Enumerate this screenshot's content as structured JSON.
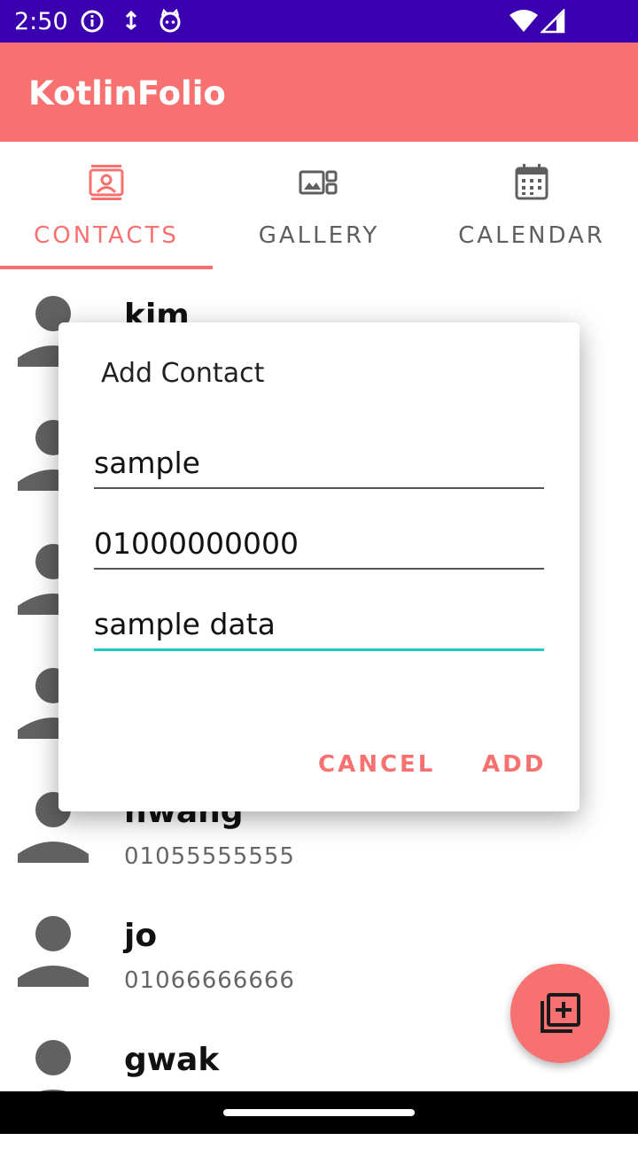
{
  "status_bar": {
    "time": "2:50",
    "icons": [
      "info-icon",
      "usb-debug-icon",
      "cat-icon",
      "wifi-icon",
      "signal-icon"
    ]
  },
  "app_bar": {
    "title": "KotlinFolio",
    "color": "#f87171"
  },
  "tabs": [
    {
      "label": "CONTACTS",
      "icon": "contacts-icon",
      "active": true
    },
    {
      "label": "GALLERY",
      "icon": "gallery-icon",
      "active": false
    },
    {
      "label": "CALENDAR",
      "icon": "calendar-icon",
      "active": false
    }
  ],
  "contacts": [
    {
      "name": "kim",
      "phone": ""
    },
    {
      "name": "",
      "phone": ""
    },
    {
      "name": "",
      "phone": ""
    },
    {
      "name": "",
      "phone": ""
    },
    {
      "name": "hwang",
      "phone": "01055555555"
    },
    {
      "name": "jo",
      "phone": "01066666666"
    },
    {
      "name": "gwak",
      "phone": ""
    }
  ],
  "dialog": {
    "title": "Add Contact",
    "name_value": "sample",
    "phone_value": "01000000000",
    "memo_value": "sample data",
    "cancel_label": "CANCEL",
    "add_label": "ADD",
    "accent_color": "#1ec9c2"
  },
  "fab": {
    "icon": "add-to-library-icon"
  }
}
